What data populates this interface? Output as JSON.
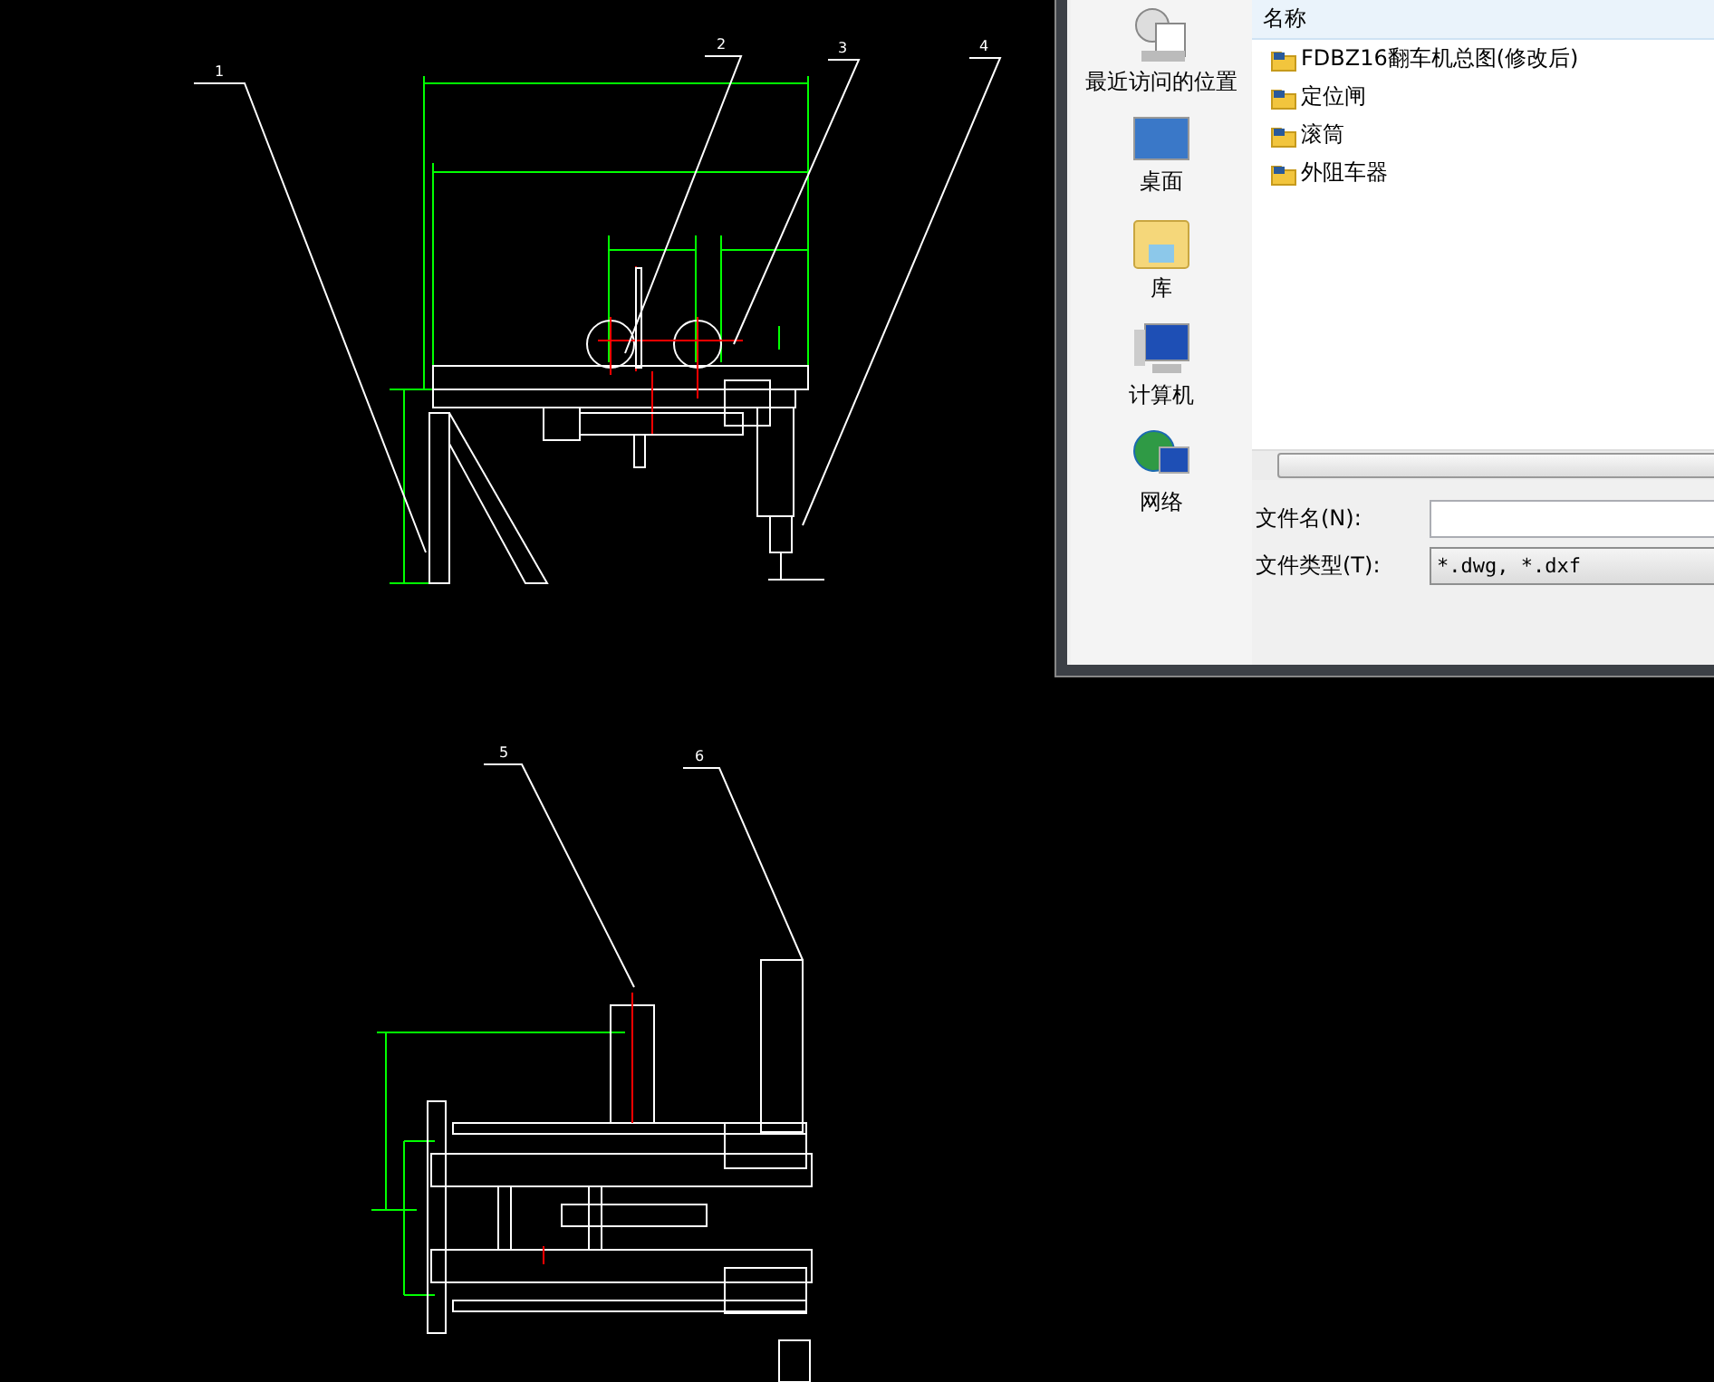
{
  "drawing": {
    "part_labels": [
      "1",
      "2",
      "3",
      "4",
      "5",
      "6"
    ]
  },
  "dialog": {
    "places": [
      {
        "kind": "recent",
        "label": "最近访问的位置"
      },
      {
        "kind": "desktop",
        "label": "桌面"
      },
      {
        "kind": "library",
        "label": "库"
      },
      {
        "kind": "computer",
        "label": "计算机"
      },
      {
        "kind": "network",
        "label": "网络"
      }
    ],
    "column_header": "名称",
    "files": [
      "FDBZ16翻车机总图(修改后)",
      "定位闸",
      "滚筒",
      "外阻车器"
    ],
    "file_name": {
      "label": "文件名(N):"
    },
    "file_type": {
      "label": "文件类型(T):",
      "value": "*.dwg, *.dxf"
    }
  }
}
